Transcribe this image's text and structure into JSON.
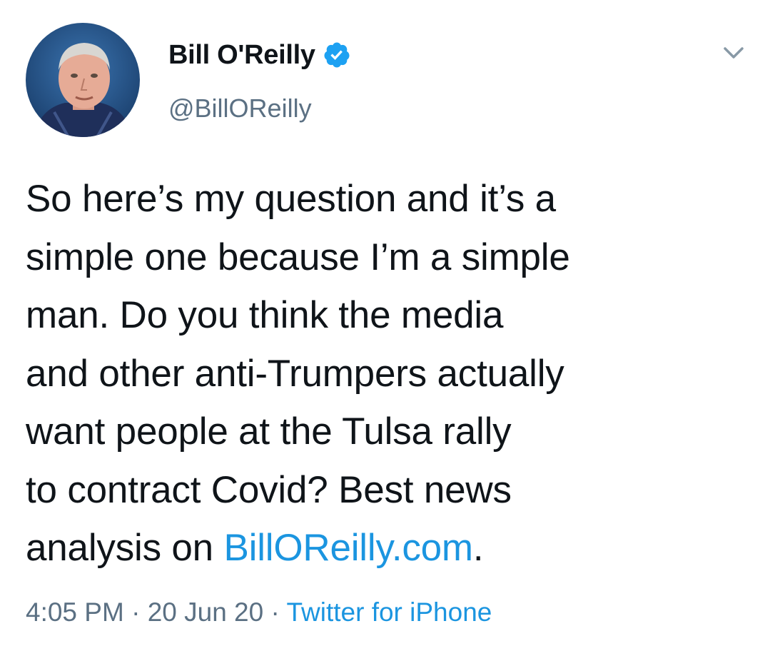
{
  "author": {
    "display_name": "Bill O'Reilly",
    "handle": "@BillOReilly",
    "verified": true
  },
  "tweet": {
    "lines": [
      "So here’s my question and it’s a",
      "simple one because I’m a simple",
      "man. Do you think the media",
      "and other anti-Trumpers actually",
      "want people at the Tulsa rally",
      "to contract Covid? Best news"
    ],
    "last_line_prefix": "analysis on ",
    "link_text": "BillOReilly.com",
    "last_line_suffix": "."
  },
  "meta": {
    "time": "4:05 PM",
    "separator": "·",
    "date": "20 Jun 20",
    "source": "Twitter for iPhone"
  },
  "colors": {
    "link": "#1b95e0",
    "secondary_text": "#5b7083",
    "verified_badge": "#1da1f2"
  },
  "icons": {
    "verified": "verified-badge-icon",
    "menu": "chevron-down-icon"
  }
}
